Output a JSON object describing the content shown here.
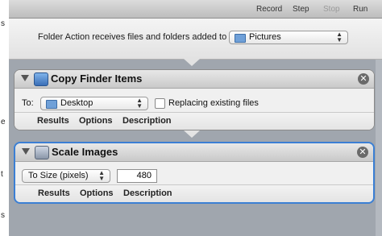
{
  "toolbar": {
    "record": "Record",
    "step": "Step",
    "stop": "Stop",
    "run": "Run"
  },
  "left_strip": {
    "fragments": [
      "s",
      "e",
      "t",
      "s"
    ]
  },
  "folder_action": {
    "label": "Folder Action receives files and folders added to",
    "target": "Pictures"
  },
  "actions": [
    {
      "title": "Copy Finder Items",
      "to_label": "To:",
      "destination": "Desktop",
      "replace_label": "Replacing existing files",
      "replace_checked": false,
      "tabs": [
        "Results",
        "Options",
        "Description"
      ]
    },
    {
      "title": "Scale Images",
      "mode": "To Size (pixels)",
      "size_value": "480",
      "tabs": [
        "Results",
        "Options",
        "Description"
      ]
    }
  ],
  "colors": {
    "selection_border": "#3b7fd4",
    "workflow_bg": "#a0a6ae"
  }
}
